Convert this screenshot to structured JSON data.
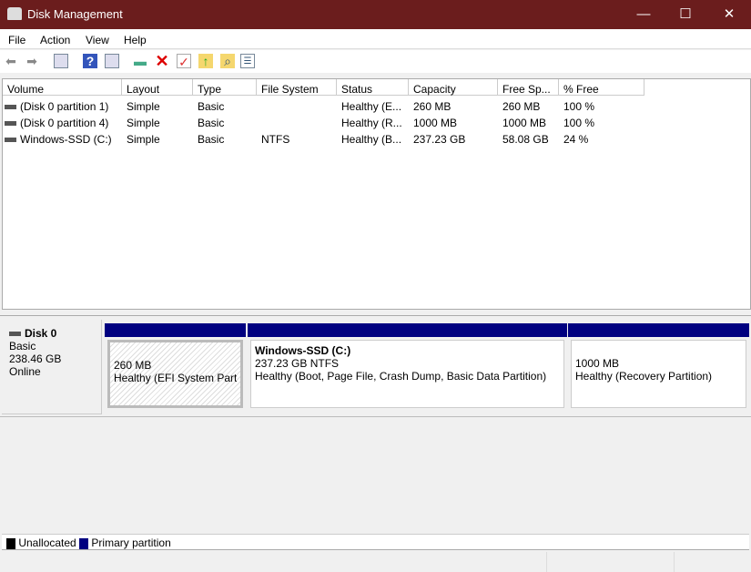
{
  "window": {
    "title": "Disk Management",
    "minimize": "—",
    "maximize": "☐",
    "close": "✕"
  },
  "menu": [
    "File",
    "Action",
    "View",
    "Help"
  ],
  "toolbar": {
    "icons": [
      "back-icon",
      "forward-icon",
      "console-tree-icon",
      "help-icon",
      "action-pane-icon",
      "connect-disk-icon",
      "delete-icon",
      "check-icon",
      "folder-up-icon",
      "folder-search-icon",
      "properties-icon"
    ]
  },
  "volumes": {
    "columns": [
      "Volume",
      "Layout",
      "Type",
      "File System",
      "Status",
      "Capacity",
      "Free Sp...",
      "% Free"
    ],
    "rows": [
      [
        "(Disk 0 partition 1)",
        "Simple",
        "Basic",
        "",
        "Healthy (E...",
        "260 MB",
        "260 MB",
        "100 %"
      ],
      [
        "(Disk 0 partition 4)",
        "Simple",
        "Basic",
        "",
        "Healthy (R...",
        "1000 MB",
        "1000 MB",
        "100 %"
      ],
      [
        "Windows-SSD (C:)",
        "Simple",
        "Basic",
        "NTFS",
        "Healthy (B...",
        "237.23 GB",
        "58.08 GB",
        "24 %"
      ]
    ]
  },
  "disk": {
    "name": "Disk 0",
    "type": "Basic",
    "size": "238.46 GB",
    "status": "Online",
    "partitions": [
      {
        "title": "",
        "size": "260 MB",
        "status": "Healthy (EFI System Partiti"
      },
      {
        "title": "Windows-SSD  (C:)",
        "size": "237.23 GB NTFS",
        "status": "Healthy (Boot, Page File, Crash Dump, Basic Data Partition)"
      },
      {
        "title": "",
        "size": "1000 MB",
        "status": "Healthy (Recovery Partition)"
      }
    ]
  },
  "legend": [
    {
      "label": "Unallocated",
      "color": "#000000"
    },
    {
      "label": "Primary partition",
      "color": "#000080"
    }
  ]
}
